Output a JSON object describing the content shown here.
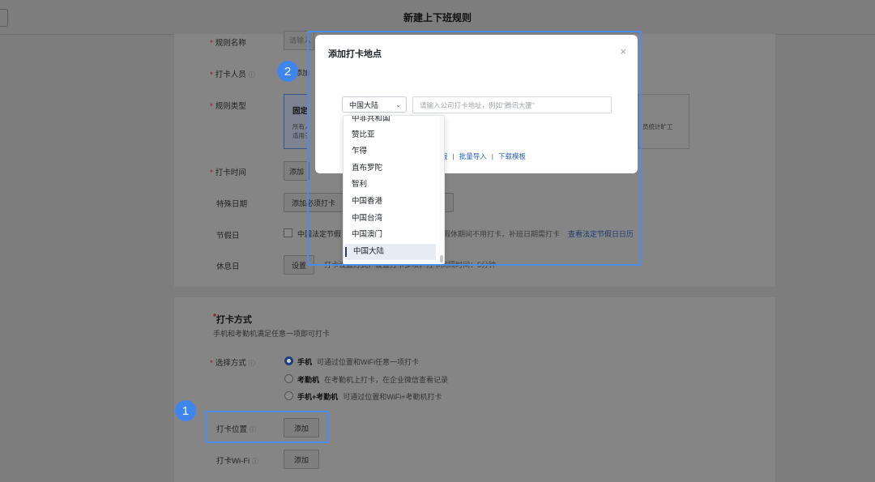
{
  "page": {
    "title": "新建上下班规则"
  },
  "form": {
    "rule_name_label": "规则名称",
    "rule_name_placeholder": "请输入",
    "members_label": "打卡人员",
    "members_add": "添加",
    "rule_type_label": "规则类型",
    "rule_type_card_title": "固定上",
    "rule_type_card_desc_line1": "所有人",
    "rule_type_card_desc_line2": "适用于",
    "rule_type_card2_desc": "员统计旷工",
    "clock_time_label": "打卡时间",
    "clock_time_add": "添加",
    "special_date_label": "特殊日期",
    "special_date_add": "添加必须打卡",
    "holiday_label": "节假日",
    "holiday_text": "中国法定节假",
    "holiday_desc": "假休期间不用打卡，补班日期需打卡",
    "holiday_link": "查看法定节假日日历",
    "rest_label": "休息日",
    "rest_set": "设置",
    "rest_desc": "打卡设置方式，设置打卡多项，打卡间隔时间：5分钟"
  },
  "checkin": {
    "section_title": "打卡方式",
    "section_sub": "手机和考勤机满足任意一项即可打卡",
    "method_label": "选择方式",
    "options": [
      {
        "label": "手机",
        "desc": "可通过位置和WiFi任意一项打卡",
        "selected": true
      },
      {
        "label": "考勤机",
        "desc": "在考勤机上打卡，在企业微信查看记录",
        "selected": false
      },
      {
        "label": "手机+考勤机",
        "desc": "可通过位置和WiFi+考勤机打卡",
        "selected": false
      }
    ],
    "location_label": "打卡位置",
    "location_add": "添加",
    "wifi_label": "打卡Wi-Fi",
    "wifi_add": "添加"
  },
  "badges": {
    "one": "1",
    "two": "2"
  },
  "modal": {
    "title": "添加打卡地点",
    "close": "×",
    "region_value": "中国大陆",
    "address_placeholder": "请输入公司打卡地址，例如“腾讯大厦”",
    "links": [
      "报",
      "批量导入",
      "下载模板"
    ],
    "link_sep": "|"
  },
  "dropdown": {
    "items": [
      "中非共和国",
      "赞比亚",
      "乍得",
      "直布罗陀",
      "智利",
      "中国香港",
      "中国台湾",
      "中国澳门",
      "中国大陆"
    ],
    "selected_index": 8
  },
  "colors": {
    "accent": "#3e86ee",
    "highlight": "#4a8cf0",
    "link": "#2f5fbf"
  },
  "icons": {
    "info": "info-icon",
    "caret": "chevron-down-icon",
    "close": "close-icon"
  }
}
